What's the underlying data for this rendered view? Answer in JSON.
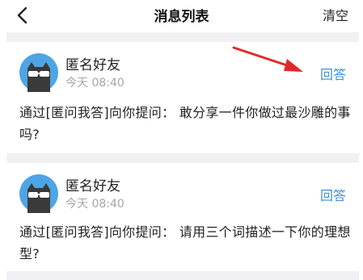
{
  "header": {
    "title": "消息列表",
    "clear_label": "清空"
  },
  "messages": [
    {
      "sender": "匿名好友",
      "time": "今天 08:40",
      "answer_label": "回答",
      "question": "通过[匿问我答]向你提问：  敢分享一件你做过最沙雕的事吗?"
    },
    {
      "sender": "匿名好友",
      "time": "今天 08:40",
      "answer_label": "回答",
      "question": "通过[匿问我答]向你提问：  请用三个词描述一下你的理想型?"
    }
  ],
  "colors": {
    "accent": "#3c8fd8",
    "annotation_arrow": "#e02a2a",
    "avatar_bg": "#4ea5e6",
    "separator": "#f1f1f3"
  },
  "icons": [
    "back-chevron-icon",
    "anonymous-cat-avatar-icon",
    "red-arrow-annotation"
  ]
}
